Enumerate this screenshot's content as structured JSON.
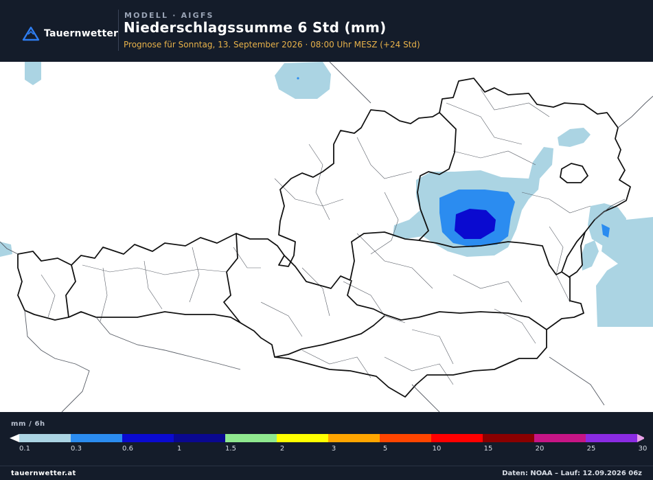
{
  "header": {
    "logo_text": "Tauernwetter",
    "model_label": "MODELL · AIGFS",
    "title": "Niederschlagssumme 6 Std (mm)",
    "subtitle": "Prognose für Sonntag, 13. September 2026 · 08:00 Uhr MESZ  (+24 Std)"
  },
  "legend": {
    "unit": "mm / 6h",
    "ticks": [
      "0.1",
      "0.3",
      "0.6",
      "1",
      "1.5",
      "2",
      "3",
      "5",
      "10",
      "15",
      "20",
      "25",
      "30"
    ],
    "colors": [
      "#abd4e3",
      "#2b8cf0",
      "#0a0ad0",
      "#0a0890",
      "#8fe88f",
      "#ffff00",
      "#ffa500",
      "#ff4500",
      "#ff0000",
      "#8b0000",
      "#c71585",
      "#8a2be2"
    ],
    "arrow_low_color": "#ffffff",
    "arrow_high_color": "#e8a0e8"
  },
  "colors": {
    "background": "#141c2a",
    "accent": "#e8b24a",
    "logo": "#2e7df0"
  },
  "footer": {
    "site": "tauernwetter.at",
    "source": "Daten: NOAA – Lauf: 12.09.2026 06z"
  }
}
